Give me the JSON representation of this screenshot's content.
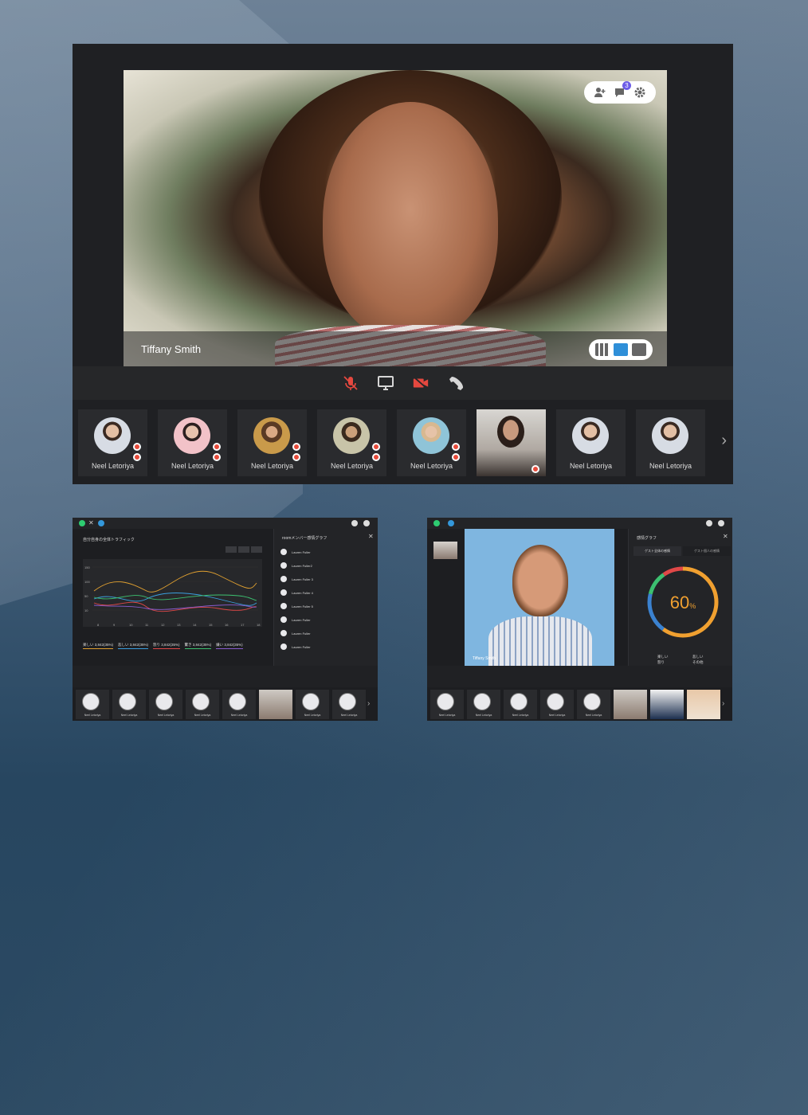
{
  "main": {
    "speaker_name": "Tiffany Smith",
    "notification_count": "3",
    "participants": [
      {
        "name": "Neel Letoriya",
        "type": "avatar"
      },
      {
        "name": "Neel Letoriya",
        "type": "avatar"
      },
      {
        "name": "Neel Letoriya",
        "type": "avatar"
      },
      {
        "name": "Neel Letoriya",
        "type": "avatar"
      },
      {
        "name": "Neel Letoriya",
        "type": "avatar"
      },
      {
        "name": "",
        "type": "video"
      },
      {
        "name": "Neel Letoriya",
        "type": "avatar"
      },
      {
        "name": "Neel Letoriya",
        "type": "avatar"
      }
    ]
  },
  "left_window": {
    "chart_title": "自分自身の全体トラフィック",
    "tabs": [
      "",
      "",
      ""
    ],
    "y_ticks": [
      "150",
      "100",
      "50",
      "10"
    ],
    "x_ticks": [
      "8",
      "9",
      "10",
      "11",
      "12",
      "13",
      "14",
      "15",
      "16",
      "17",
      "18"
    ],
    "legend": [
      {
        "label": "楽しい 3,842(35%)",
        "color": "#e0a030"
      },
      {
        "label": "悲しい 3,842(35%)",
        "color": "#3ba0e0"
      },
      {
        "label": "怒り 3,842(35%)",
        "color": "#e04848"
      },
      {
        "label": "驚き 3,842(35%)",
        "color": "#3cc070"
      },
      {
        "label": "嫌い 3,842(35%)",
        "color": "#8a5cd0"
      }
    ],
    "side_title": "roomメンバー感情グラフ",
    "members": [
      "Lauren Fuller",
      "Lauren Fuller2",
      "Lauren Fuller 3",
      "Lauren Fuller 4",
      "Lauren Fuller 5",
      "Lauren Fuller",
      "Lauren Fuller",
      "Lauren Fuller"
    ],
    "thumb_names": [
      "Neel Letoriya",
      "Neel Letoriya",
      "Neel Letoriya",
      "Neel Letoriya",
      "Neel Letoriya",
      "",
      "Neel Letoriya",
      "Neel Letoriya"
    ]
  },
  "right_window": {
    "panel_title": "感情グラフ",
    "tab_a": "ゲスト全体の感情",
    "tab_b": "ゲスト個人の感情",
    "percent": "60",
    "percent_unit": "%",
    "legend": [
      "楽しい",
      "悲しい",
      "怒り",
      "その他"
    ],
    "speaker_name": "Tiffany Smith",
    "thumb_names": [
      "Neel Letoriya",
      "Neel Letoriya",
      "Neel Letoriya",
      "Neel Letoriya",
      "Neel Letoriya"
    ]
  }
}
